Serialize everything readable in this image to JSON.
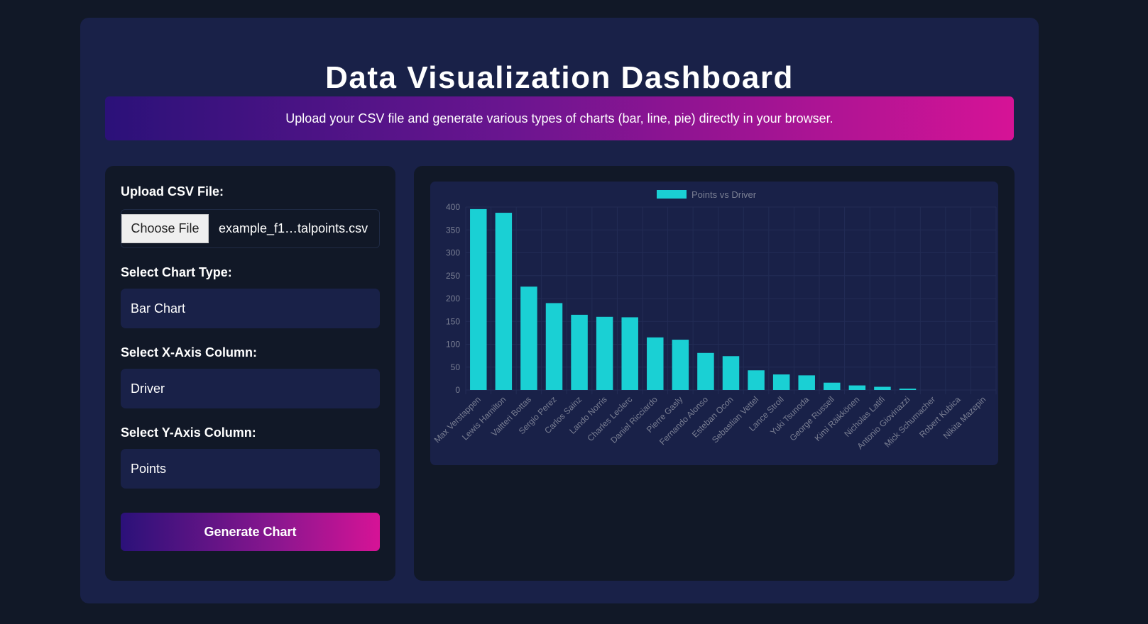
{
  "header": {
    "title": "Data Visualization Dashboard",
    "banner_text": "Upload your CSV file and generate various types of charts (bar, line, pie) directly in your browser."
  },
  "controls": {
    "upload_label": "Upload CSV File:",
    "choose_file_label": "Choose File",
    "file_name": "example_f1…talpoints.csv",
    "chart_type_label": "Select Chart Type:",
    "chart_type_value": "Bar Chart",
    "x_axis_label": "Select X-Axis Column:",
    "x_axis_value": "Driver",
    "y_axis_label": "Select Y-Axis Column:",
    "y_axis_value": "Points",
    "generate_label": "Generate Chart"
  },
  "colors": {
    "background": "#111827",
    "panel": "#192148",
    "bar": "#1ad0d4",
    "gradient_start": "#2b1179",
    "gradient_end": "#d61396"
  },
  "chart_data": {
    "type": "bar",
    "legend": "Points vs Driver",
    "categories": [
      "Max Verstappen",
      "Lewis Hamilton",
      "Valtteri Bottas",
      "Sergio Perez",
      "Carlos Sainz",
      "Lando Norris",
      "Charles Leclerc",
      "Daniel Ricciardo",
      "Pierre Gasly",
      "Fernando Alonso",
      "Esteban Ocon",
      "Sebastian Vettel",
      "Lance Stroll",
      "Yuki Tsunoda",
      "George Russell",
      "Kimi Räikkönen",
      "Nicholas Latifi",
      "Antonio Giovinazzi",
      "Mick Schumacher",
      "Robert Kubica",
      "Nikita Mazepin"
    ],
    "series": [
      {
        "name": "Points vs Driver",
        "values": [
          395.5,
          387.5,
          226,
          190,
          164.5,
          160,
          159,
          115,
          110,
          81,
          74,
          43,
          34,
          32,
          16,
          10,
          7,
          3,
          0,
          0,
          0
        ]
      }
    ],
    "y_ticks": [
      0,
      50,
      100,
      150,
      200,
      250,
      300,
      350,
      400
    ],
    "ylim": [
      0,
      400
    ],
    "grid": true,
    "legend_position": "top"
  }
}
